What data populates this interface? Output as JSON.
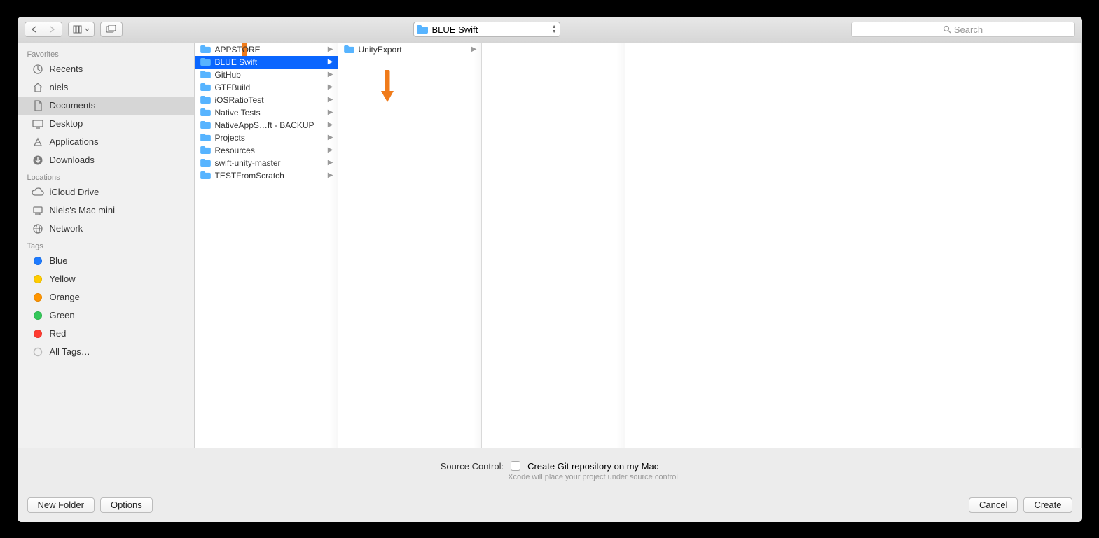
{
  "toolbar": {
    "location_label": "BLUE Swift",
    "search_placeholder": "Search"
  },
  "sidebar": {
    "sections": [
      {
        "header": "Favorites",
        "items": [
          {
            "icon": "clock",
            "label": "Recents"
          },
          {
            "icon": "home",
            "label": "niels"
          },
          {
            "icon": "doc",
            "label": "Documents",
            "selected": true
          },
          {
            "icon": "desktop",
            "label": "Desktop"
          },
          {
            "icon": "apps",
            "label": "Applications"
          },
          {
            "icon": "download",
            "label": "Downloads"
          }
        ]
      },
      {
        "header": "Locations",
        "items": [
          {
            "icon": "cloud",
            "label": "iCloud Drive"
          },
          {
            "icon": "computer",
            "label": "Niels's Mac mini"
          },
          {
            "icon": "network",
            "label": "Network"
          }
        ]
      },
      {
        "header": "Tags",
        "items": [
          {
            "icon": "tag",
            "color": "#1e7bff",
            "label": "Blue"
          },
          {
            "icon": "tag",
            "color": "#ffcc00",
            "label": "Yellow"
          },
          {
            "icon": "tag",
            "color": "#ff9500",
            "label": "Orange"
          },
          {
            "icon": "tag",
            "color": "#34c759",
            "label": "Green"
          },
          {
            "icon": "tag",
            "color": "#ff3b30",
            "label": "Red"
          },
          {
            "icon": "alltags",
            "label": "All Tags…"
          }
        ]
      }
    ]
  },
  "columns": [
    {
      "items": [
        {
          "label": "APPSTORE"
        },
        {
          "label": "BLUE Swift",
          "selected": true
        },
        {
          "label": "GitHub"
        },
        {
          "label": "GTFBuild"
        },
        {
          "label": "iOSRatioTest"
        },
        {
          "label": "Native Tests"
        },
        {
          "label": "NativeAppS…ft - BACKUP"
        },
        {
          "label": "Projects"
        },
        {
          "label": "Resources"
        },
        {
          "label": "swift-unity-master"
        },
        {
          "label": "TESTFromScratch"
        }
      ]
    },
    {
      "items": [
        {
          "label": "UnityExport"
        }
      ]
    },
    {
      "items": []
    },
    {
      "items": []
    },
    {
      "items": []
    },
    {
      "items": []
    }
  ],
  "options": {
    "label": "Source Control:",
    "checkbox_label": "Create Git repository on my Mac",
    "hint": "Xcode will place your project under source control"
  },
  "footer": {
    "new_folder": "New Folder",
    "options": "Options",
    "cancel": "Cancel",
    "create": "Create"
  }
}
